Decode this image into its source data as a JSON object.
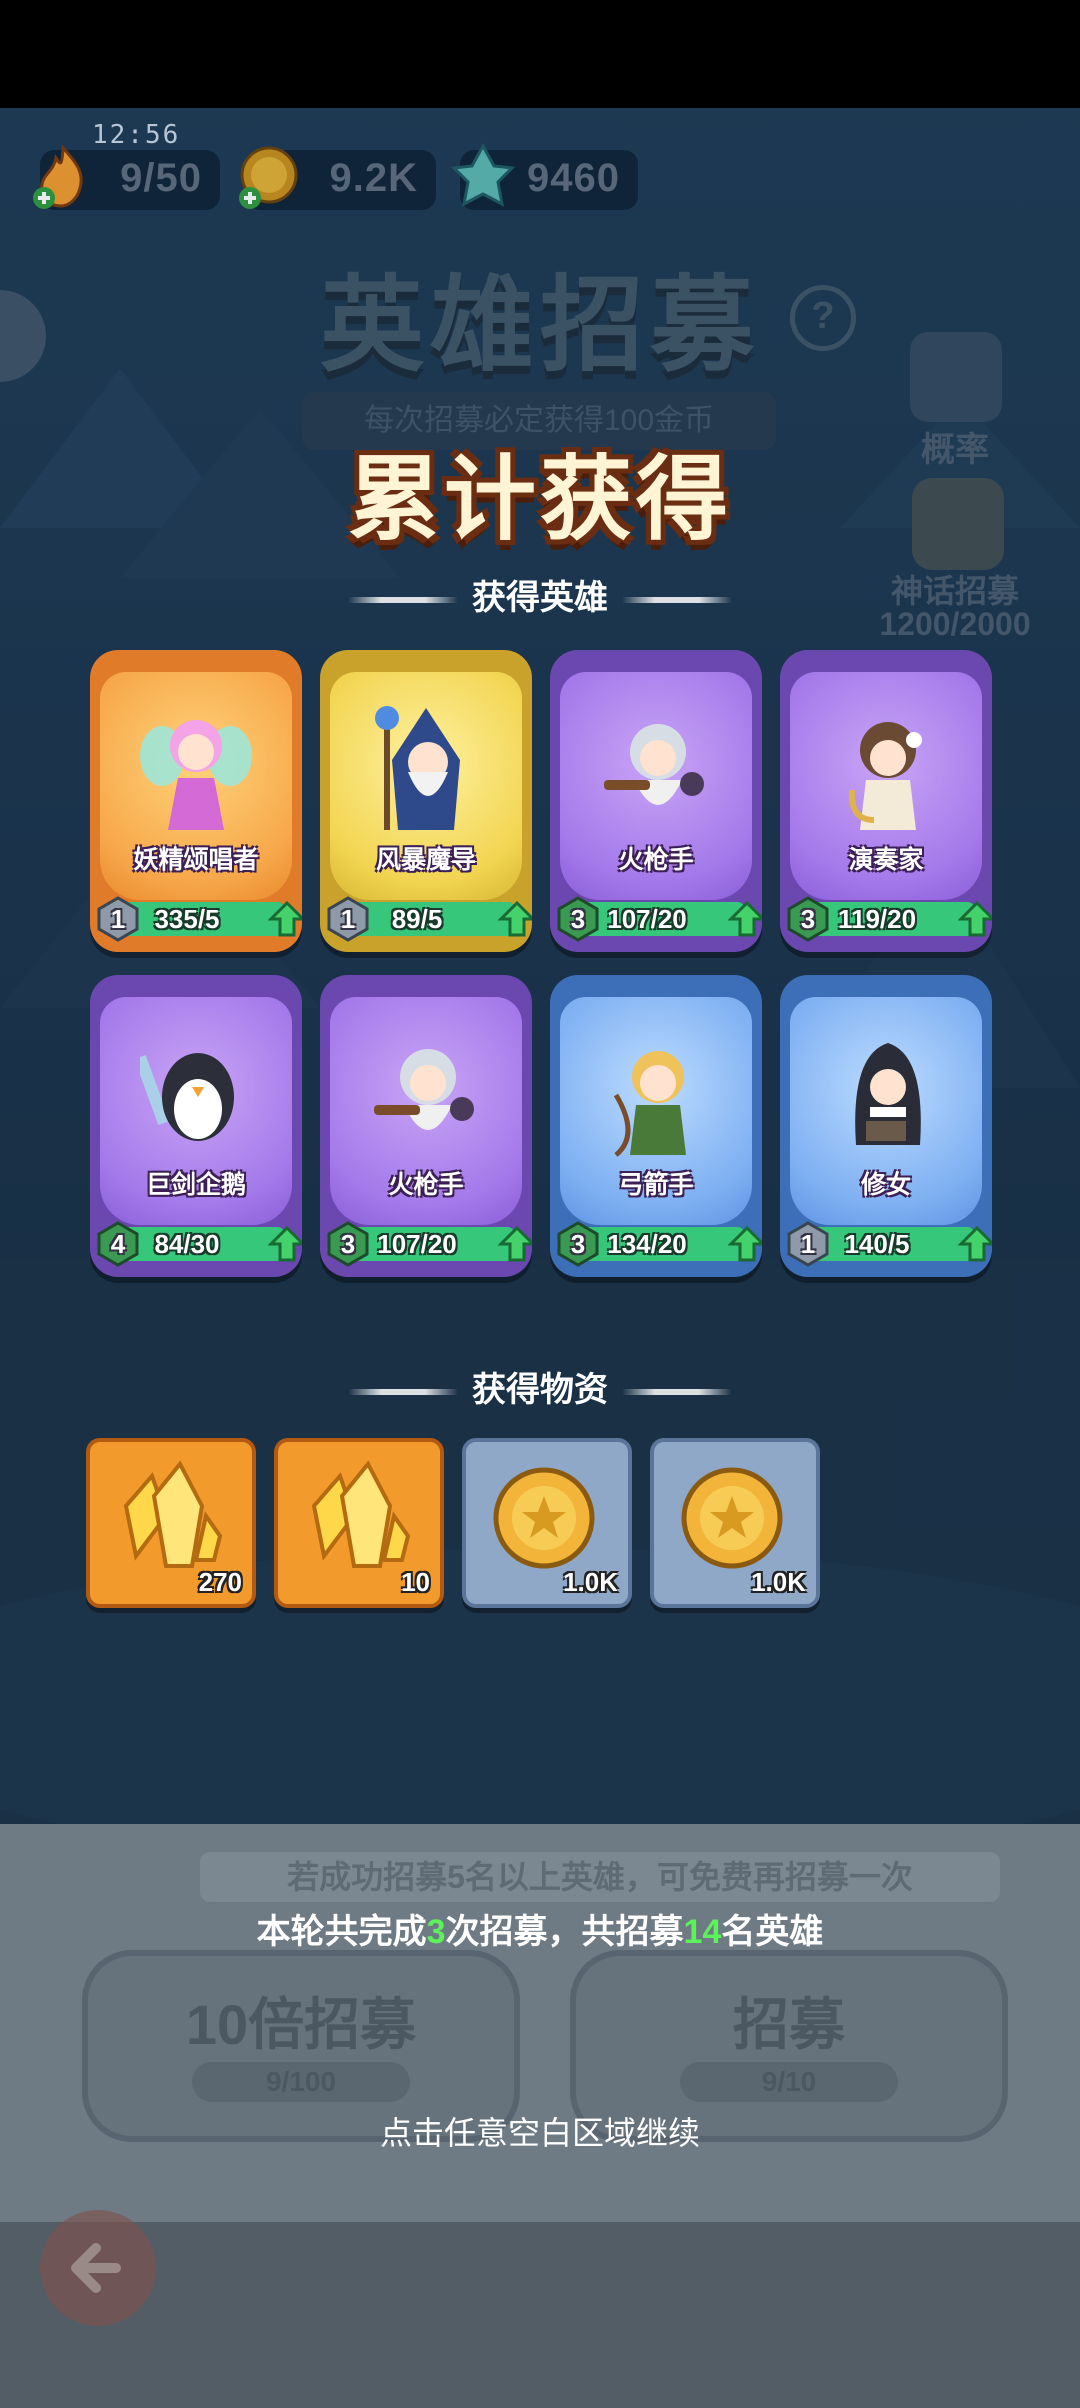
{
  "status": {
    "time": "12:56"
  },
  "resources": [
    {
      "icon": "flame-energy-icon",
      "value": "9/50"
    },
    {
      "icon": "gold-coin-icon",
      "value": "9.2K"
    },
    {
      "icon": "crystal-gem-icon",
      "value": "9460"
    }
  ],
  "background": {
    "title": "英雄招募",
    "banner": "每次招募必定获得100金币",
    "probability_label": "概率",
    "myth_label": "神话招募",
    "myth_progress": "1200/2000"
  },
  "result": {
    "title": "累计获得",
    "heroes_section": "获得英雄",
    "items_section": "获得物资"
  },
  "heroes": [
    {
      "name": "妖精颂唱者",
      "level": "1",
      "progress": "335/5",
      "rarity": "orange"
    },
    {
      "name": "风暴魔导",
      "level": "1",
      "progress": "89/5",
      "rarity": "gold"
    },
    {
      "name": "火枪手",
      "level": "3",
      "progress": "107/20",
      "rarity": "purple"
    },
    {
      "name": "演奏家",
      "level": "3",
      "progress": "119/20",
      "rarity": "purple"
    },
    {
      "name": "巨剑企鹅",
      "level": "4",
      "progress": "84/30",
      "rarity": "purple"
    },
    {
      "name": "火枪手",
      "level": "3",
      "progress": "107/20",
      "rarity": "purple"
    },
    {
      "name": "弓箭手",
      "level": "3",
      "progress": "134/20",
      "rarity": "blue"
    },
    {
      "name": "修女",
      "level": "1",
      "progress": "140/5",
      "rarity": "blue"
    }
  ],
  "items": [
    {
      "icon": "crystal-icon",
      "qty": "270"
    },
    {
      "icon": "crystal-icon",
      "qty": "10"
    },
    {
      "icon": "gold-coin-icon",
      "qty": "1.0K"
    },
    {
      "icon": "gold-coin-icon",
      "qty": "1.0K"
    }
  ],
  "bottom": {
    "hint": "若成功招募5名以上英雄，可免费再招募一次",
    "summary_a": "本轮共完成",
    "summary_count": "3",
    "summary_b": "次招募，共招募",
    "summary_heroes": "14",
    "summary_c": "名英雄",
    "btn_ten_label": "10倍招募",
    "btn_ten_keys": "9/100",
    "btn_one_label": "招募",
    "btn_one_keys": "9/10",
    "continue": "点击任意空白区域继续"
  }
}
